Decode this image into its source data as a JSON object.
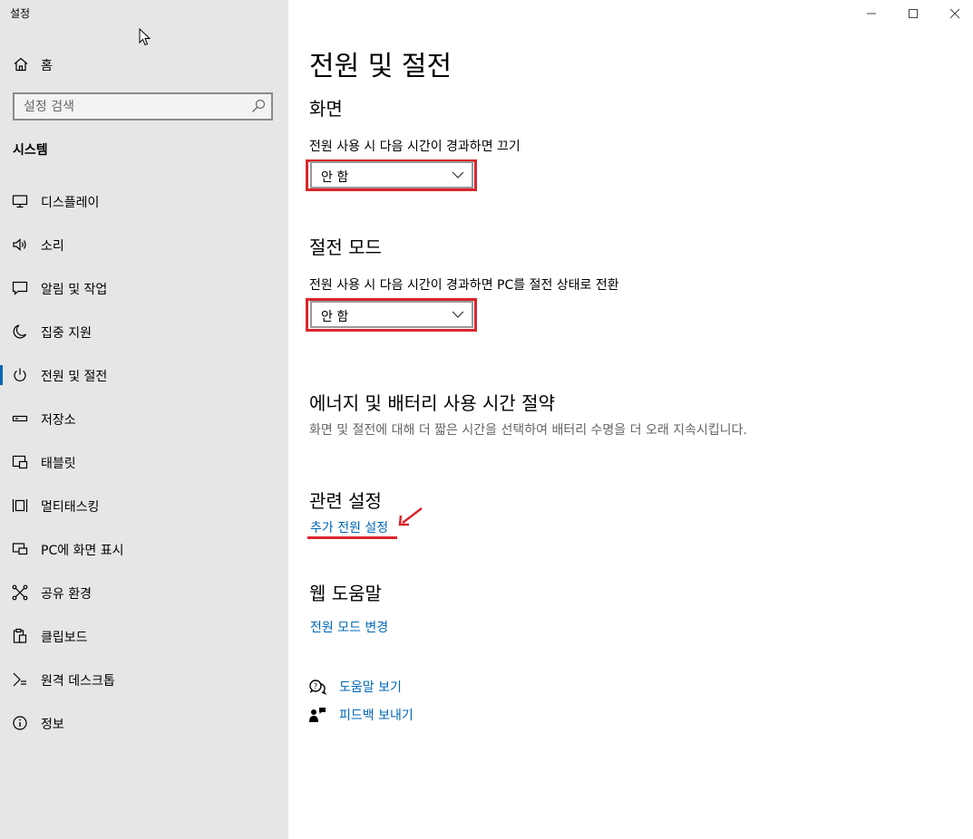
{
  "app": {
    "title": "설정"
  },
  "sidebar": {
    "home_label": "홈",
    "search_placeholder": "설정 검색",
    "section_label": "시스템",
    "items": [
      {
        "label": "디스플레이",
        "icon": "monitor-icon"
      },
      {
        "label": "소리",
        "icon": "speaker-icon"
      },
      {
        "label": "알림 및 작업",
        "icon": "notification-icon"
      },
      {
        "label": "집중 지원",
        "icon": "moon-icon"
      },
      {
        "label": "전원 및 절전",
        "icon": "power-icon",
        "active": true
      },
      {
        "label": "저장소",
        "icon": "storage-icon"
      },
      {
        "label": "태블릿",
        "icon": "tablet-icon"
      },
      {
        "label": "멀티태스킹",
        "icon": "multitasking-icon"
      },
      {
        "label": "PC에 화면 표시",
        "icon": "project-icon"
      },
      {
        "label": "공유 환경",
        "icon": "share-icon"
      },
      {
        "label": "클립보드",
        "icon": "clipboard-icon"
      },
      {
        "label": "원격 데스크톱",
        "icon": "remote-desktop-icon"
      },
      {
        "label": "정보",
        "icon": "info-icon"
      }
    ]
  },
  "main": {
    "title": "전원 및 절전",
    "screen": {
      "heading": "화면",
      "label": "전원 사용 시 다음 시간이 경과하면 끄기",
      "value": "안 함"
    },
    "sleep": {
      "heading": "절전 모드",
      "label": "전원 사용 시 다음 시간이 경과하면 PC를 절전 상태로 전환",
      "value": "안 함"
    },
    "energy": {
      "heading": "에너지 및 배터리 사용 시간 절약",
      "description": "화면 및 절전에 대해 더 짧은 시간을 선택하여 배터리 수명을 더 오래 지속시킵니다."
    },
    "related": {
      "heading": "관련 설정",
      "link": "추가 전원 설정"
    },
    "web_help": {
      "heading": "웹 도움말",
      "link": "전원 모드 변경"
    },
    "help": {
      "get_help": "도움말 보기",
      "feedback": "피드백 보내기"
    }
  },
  "colors": {
    "accent": "#0067b8",
    "highlight": "#d9262c",
    "sidebar_bg": "#e6e6e6"
  }
}
